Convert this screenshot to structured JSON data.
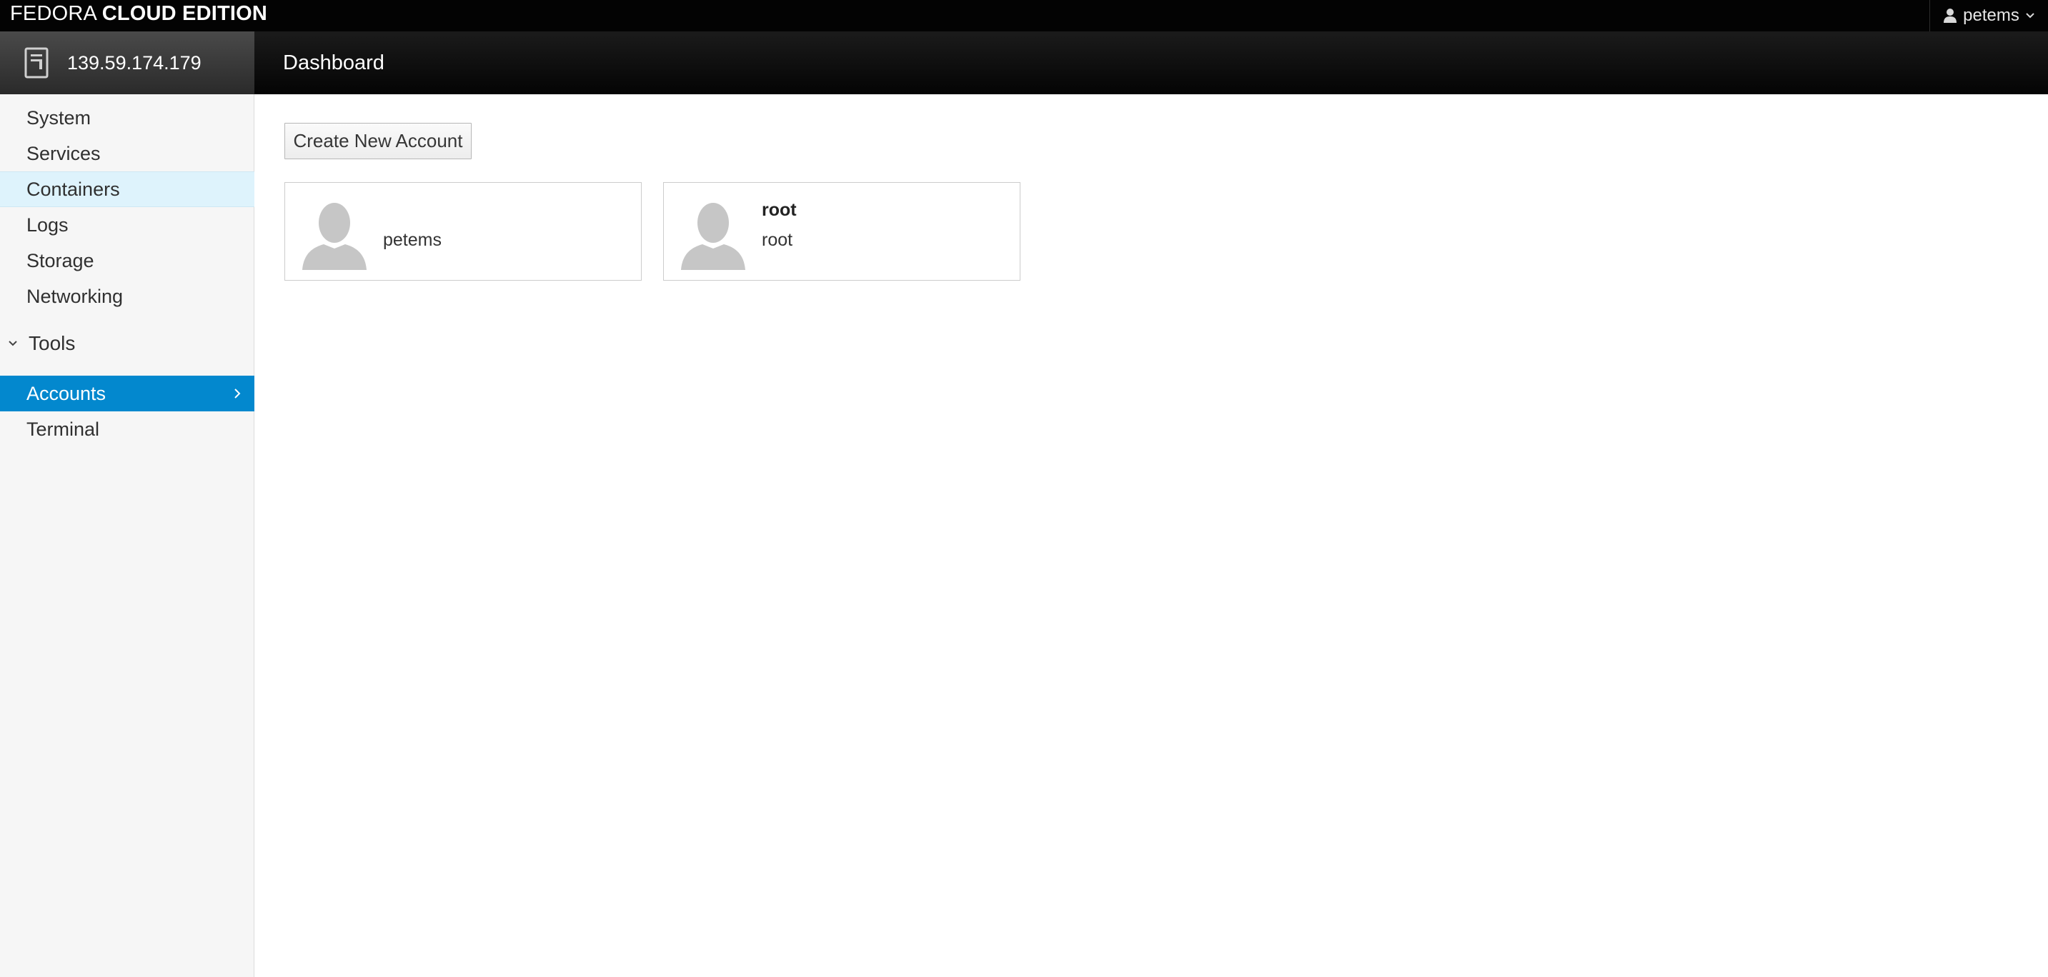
{
  "brand": {
    "light": "FEDORA ",
    "bold": "CLOUD EDITION"
  },
  "user_menu": {
    "username": "petems"
  },
  "host": {
    "address": "139.59.174.179"
  },
  "page": {
    "title": "Dashboard"
  },
  "sidebar": {
    "items": [
      {
        "label": "System"
      },
      {
        "label": "Services"
      },
      {
        "label": "Containers"
      },
      {
        "label": "Logs"
      },
      {
        "label": "Storage"
      },
      {
        "label": "Networking"
      }
    ],
    "group": {
      "label": "Tools"
    },
    "tools": [
      {
        "label": "Accounts"
      },
      {
        "label": "Terminal"
      }
    ]
  },
  "main": {
    "create_button": "Create New Account",
    "accounts": [
      {
        "full_name": "",
        "username": "petems"
      },
      {
        "full_name": "root",
        "username": "root"
      }
    ]
  },
  "colors": {
    "accent": "#0388ce",
    "hover": "#def3fc",
    "topbar": "#030303"
  }
}
